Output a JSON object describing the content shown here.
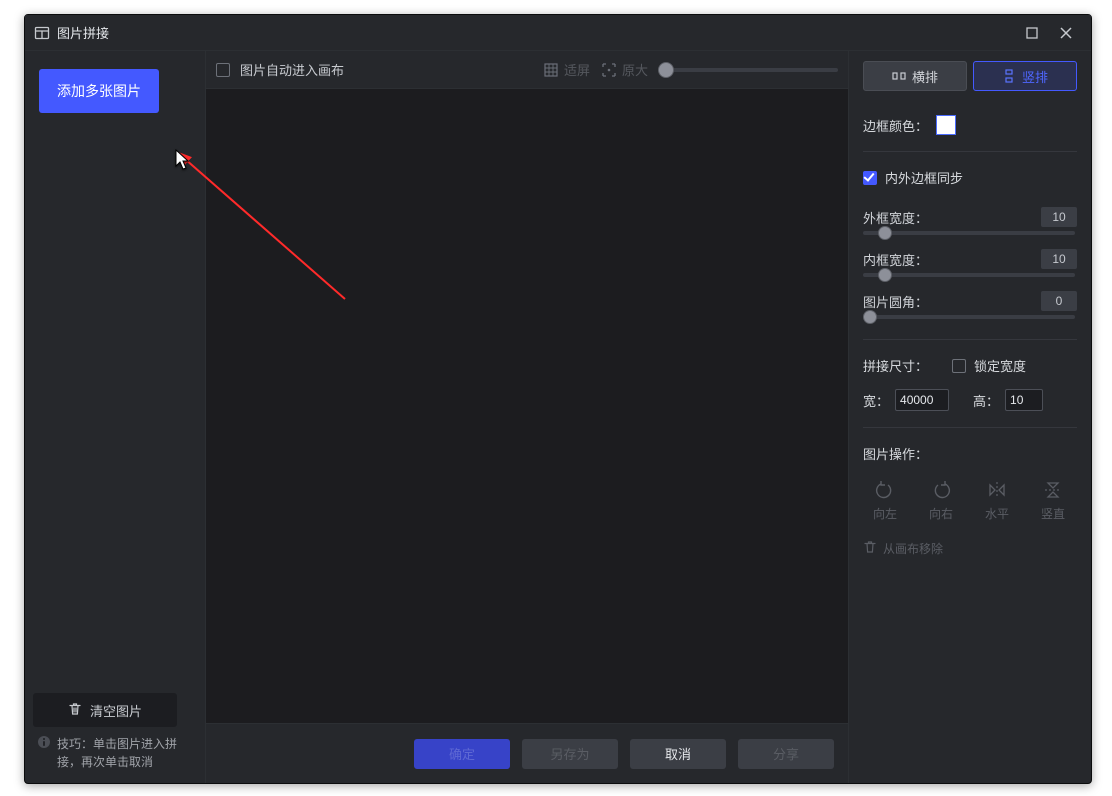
{
  "titlebar": {
    "title": "图片拼接"
  },
  "left": {
    "add_btn": "添加多张图片",
    "clear_btn": "清空图片",
    "tip_label": "技巧：",
    "tip_text": "单击图片进入拼接，再次单击取消"
  },
  "center_toolbar": {
    "auto_canvas": "图片自动进入画布",
    "fit": "适屏",
    "actual": "原大"
  },
  "footer": {
    "confirm": "确定",
    "save_as": "另存为",
    "cancel": "取消",
    "share": "分享"
  },
  "right": {
    "mode_h": "横排",
    "mode_v": "竖排",
    "border_color": "边框颜色：",
    "sync_label": "内外边框同步",
    "outer_w": "外框宽度：",
    "outer_val": "10",
    "inner_w": "内框宽度：",
    "inner_val": "10",
    "radius": "图片圆角：",
    "radius_val": "0",
    "size_label": "拼接尺寸：",
    "lock_w": "锁定宽度",
    "width_label": "宽：",
    "width_val": "40000",
    "height_label": "高：",
    "height_val": "10",
    "ops_label": "图片操作：",
    "op_left": "向左",
    "op_right": "向右",
    "op_flip_h": "水平",
    "op_flip_v": "竖直",
    "remove": "从画布移除"
  }
}
